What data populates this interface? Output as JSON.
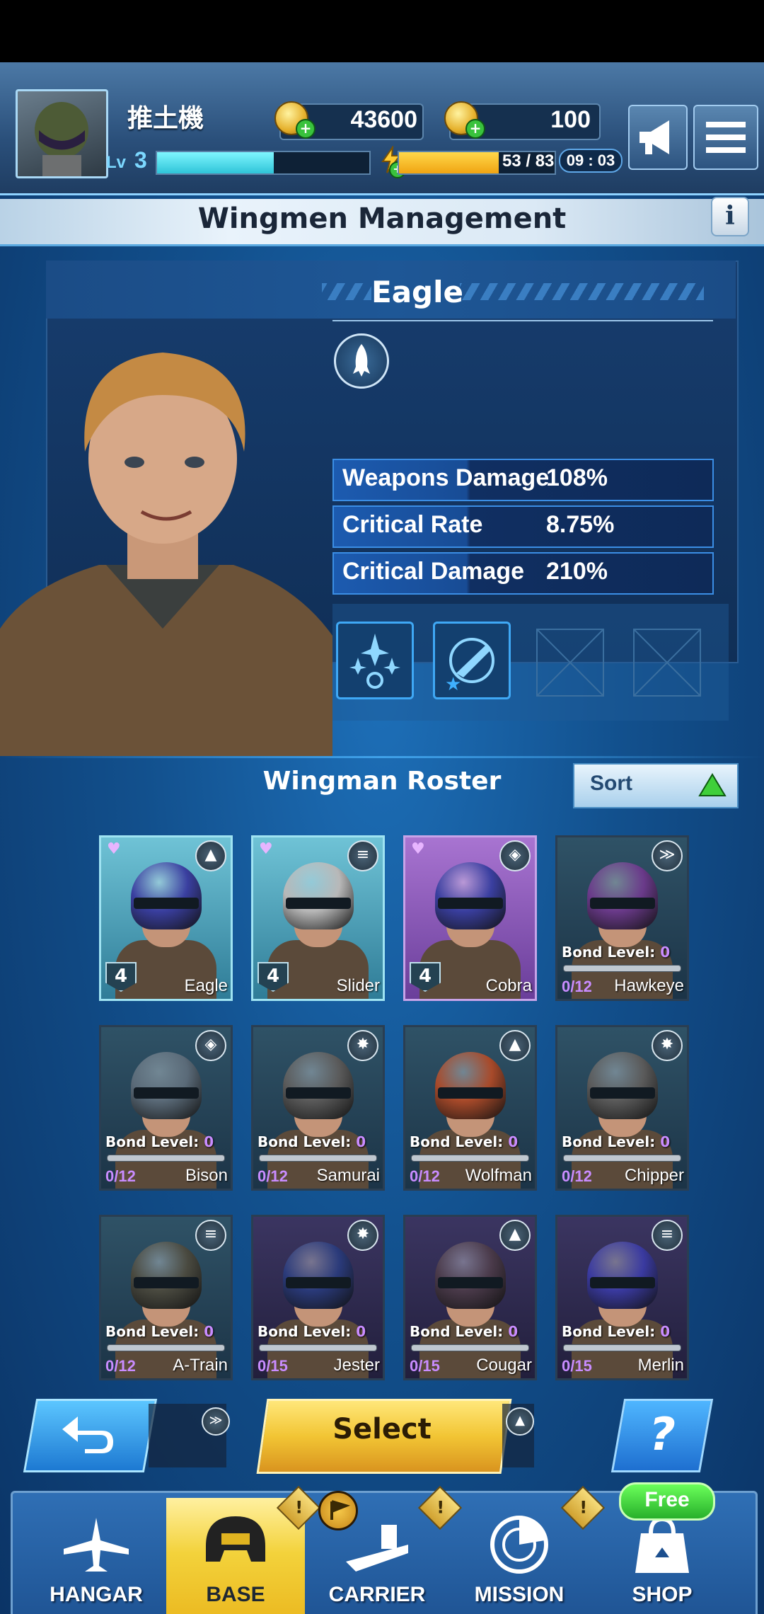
{
  "header": {
    "player_name": "推土機",
    "gold": "43600",
    "tokens": "100",
    "level_label": "Lv",
    "level": "3",
    "energy": "53 / 83",
    "timer": "09 : 03"
  },
  "page": {
    "title": "Wingmen Management"
  },
  "selected": {
    "name": "Eagle",
    "stats": [
      {
        "label": "Weapons Damage",
        "value": "108%"
      },
      {
        "label": "Critical Rate",
        "value": "8.75%"
      },
      {
        "label": "Critical Damage",
        "value": "210%"
      }
    ]
  },
  "roster": {
    "title": "Wingman Roster",
    "sort_label": "Sort",
    "bond_label": "Bond Level:",
    "cards": [
      {
        "name": "Eagle",
        "level": "4",
        "owned": true,
        "bond": "",
        "progress": "",
        "class_icon": "rocket-icon",
        "helmet": "#3a3fa0",
        "theme": "teal"
      },
      {
        "name": "Slider",
        "level": "4",
        "owned": true,
        "bond": "",
        "progress": "",
        "class_icon": "missiles-icon",
        "helmet": "#b8b8b8",
        "theme": "teal"
      },
      {
        "name": "Cobra",
        "level": "4",
        "owned": true,
        "bond": "",
        "progress": "",
        "class_icon": "shield-icon",
        "helmet": "#3a3fa0",
        "theme": "purple"
      },
      {
        "name": "Hawkeye",
        "level": "",
        "owned": false,
        "bond": "0",
        "progress": "0/12",
        "class_icon": "chevron-icon",
        "helmet": "#6a3a8a",
        "theme": "dark"
      },
      {
        "name": "Bison",
        "level": "",
        "owned": false,
        "bond": "0",
        "progress": "0/12",
        "class_icon": "shield-icon",
        "helmet": "#5a6a78",
        "theme": "dark"
      },
      {
        "name": "Samurai",
        "level": "",
        "owned": false,
        "bond": "0",
        "progress": "0/12",
        "class_icon": "burst-icon",
        "helmet": "#5a5a5a",
        "theme": "dark"
      },
      {
        "name": "Wolfman",
        "level": "",
        "owned": false,
        "bond": "0",
        "progress": "0/12",
        "class_icon": "rocket-icon",
        "helmet": "#a84a2a",
        "theme": "dark"
      },
      {
        "name": "Chipper",
        "level": "",
        "owned": false,
        "bond": "0",
        "progress": "0/12",
        "class_icon": "burst-icon",
        "helmet": "#5a5a5a",
        "theme": "dark"
      },
      {
        "name": "A-Train",
        "level": "",
        "owned": false,
        "bond": "0",
        "progress": "0/12",
        "class_icon": "missiles-icon",
        "helmet": "#4a4a40",
        "theme": "dark"
      },
      {
        "name": "Jester",
        "level": "",
        "owned": false,
        "bond": "0",
        "progress": "0/15",
        "class_icon": "burst-icon",
        "helmet": "#2a3a7a",
        "theme": "dpurp"
      },
      {
        "name": "Cougar",
        "level": "",
        "owned": false,
        "bond": "0",
        "progress": "0/15",
        "class_icon": "rocket-icon",
        "helmet": "#4a3a4a",
        "theme": "dpurp"
      },
      {
        "name": "Merlin",
        "level": "",
        "owned": false,
        "bond": "0",
        "progress": "0/15",
        "class_icon": "missiles-icon",
        "helmet": "#3a3aa0",
        "theme": "dpurp"
      }
    ]
  },
  "actions": {
    "select_label": "Select",
    "help_label": "?"
  },
  "nav": {
    "free_label": "Free",
    "items": [
      {
        "label": "HANGAR",
        "icon": "plane-icon",
        "active": false
      },
      {
        "label": "BASE",
        "icon": "helmet-icon",
        "active": true
      },
      {
        "label": "CARRIER",
        "icon": "carrier-icon",
        "active": false
      },
      {
        "label": "MISSION",
        "icon": "radar-icon",
        "active": false
      },
      {
        "label": "SHOP",
        "icon": "bag-icon",
        "active": false
      }
    ]
  },
  "colors": {
    "accent": "#f3d23b",
    "panel": "#173d6e",
    "bond": "#c98cff"
  }
}
